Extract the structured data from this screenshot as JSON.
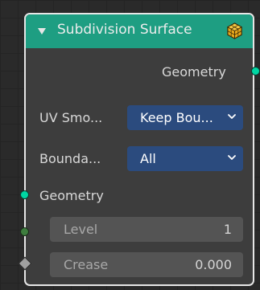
{
  "node": {
    "title": "Subdivision Surface",
    "icon": "subdivision-cube-icon",
    "header_color": "#1e9e82"
  },
  "outputs": {
    "geometry_label": "Geometry"
  },
  "properties": {
    "uv_smooth_label": "UV Smo...",
    "uv_smooth_value": "Keep Bou...",
    "boundary_label": "Bounda...",
    "boundary_value": "All"
  },
  "inputs": {
    "geometry_label": "Geometry",
    "level_label": "Level",
    "level_value": "1",
    "crease_label": "Crease",
    "crease_value": "0.000"
  },
  "colors": {
    "geometry_socket": "#00d6a3",
    "int_socket": "#3e7d3e",
    "float_socket": "#a0a0a0",
    "dropdown_bg": "#2b4b7e"
  }
}
